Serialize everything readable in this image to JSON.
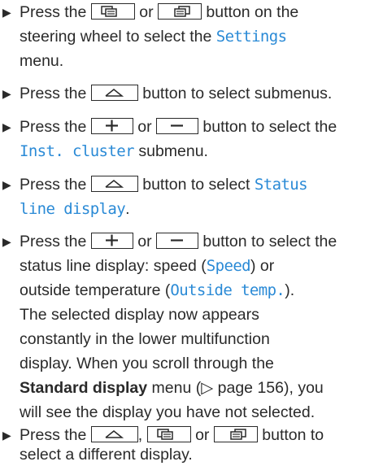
{
  "colors": {
    "text": "#2a2a2a",
    "menu_term": "#2a8ad6"
  },
  "icons": {
    "bullet": "▶",
    "menu_back_icon": "page-back-icon",
    "menu_fwd_icon": "page-forward-icon",
    "home_icon": "home-icon",
    "plus_icon": "plus-icon",
    "minus_icon": "minus-icon"
  },
  "steps": [
    {
      "l1a": "Press the",
      "l1b": "or",
      "l1c": "button on the",
      "l2a": "steering wheel to select the",
      "l2term": "Settings",
      "l3": "menu."
    },
    {
      "l1a": "Press the",
      "l1b": "button to select submenus."
    },
    {
      "l1a": "Press the",
      "l1b": "or",
      "l1c": "button to select the",
      "l2term": "Inst. cluster",
      "l2b": "submenu."
    },
    {
      "l1a": "Press the",
      "l1b": "button to select",
      "l1term": "Status",
      "l2term": "line display",
      "l2b": "."
    },
    {
      "l1a": "Press the",
      "l1b": "or",
      "l1c": "button to select the",
      "l2a": "status line display: speed (",
      "l2term": "Speed",
      "l2b": ") or",
      "l3a": "outside temperature (",
      "l3term": "Outside temp.",
      "l3b": ").",
      "l4": "The selected display now appears",
      "l5": "constantly in the lower multifunction",
      "l6": "display. When you scroll through the",
      "l7bold": "Standard display",
      "l7a": " menu (",
      "l7ref": "▷",
      "l7b": " page 156), you",
      "l8": "will see the display you have not selected."
    },
    {
      "l1a": "Press the",
      "l1b": ",",
      "l1c": "or",
      "l1d": "button to",
      "l2": "select a different display."
    }
  ]
}
